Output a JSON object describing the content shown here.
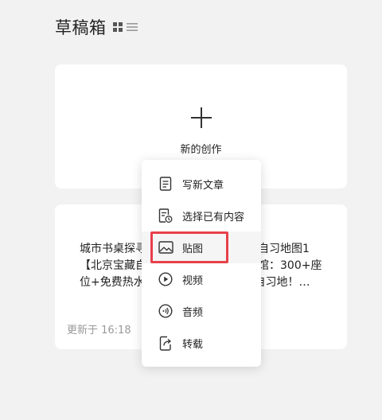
{
  "header": {
    "title": "草稿箱"
  },
  "new_card": {
    "label": "新的创作"
  },
  "draft": {
    "line1": "城市书桌探寻之旅：北京朝阳区免费自习地图1",
    "line2": "【北京宝藏自习室】朝阳区免费图书馆：300+座",
    "line3": "位+免费热水+空调，超适合学习的自习地！…",
    "updated": "更新于 16:18"
  },
  "menu": {
    "items": [
      {
        "label": "写新文章",
        "icon": "document-icon"
      },
      {
        "label": "选择已有内容",
        "icon": "history-document-icon"
      },
      {
        "label": "贴图",
        "icon": "image-icon"
      },
      {
        "label": "视频",
        "icon": "play-icon"
      },
      {
        "label": "音频",
        "icon": "audio-icon"
      },
      {
        "label": "转载",
        "icon": "repost-icon"
      }
    ]
  },
  "colors": {
    "highlight": "#e8404a",
    "background": "#f2f2f2"
  }
}
